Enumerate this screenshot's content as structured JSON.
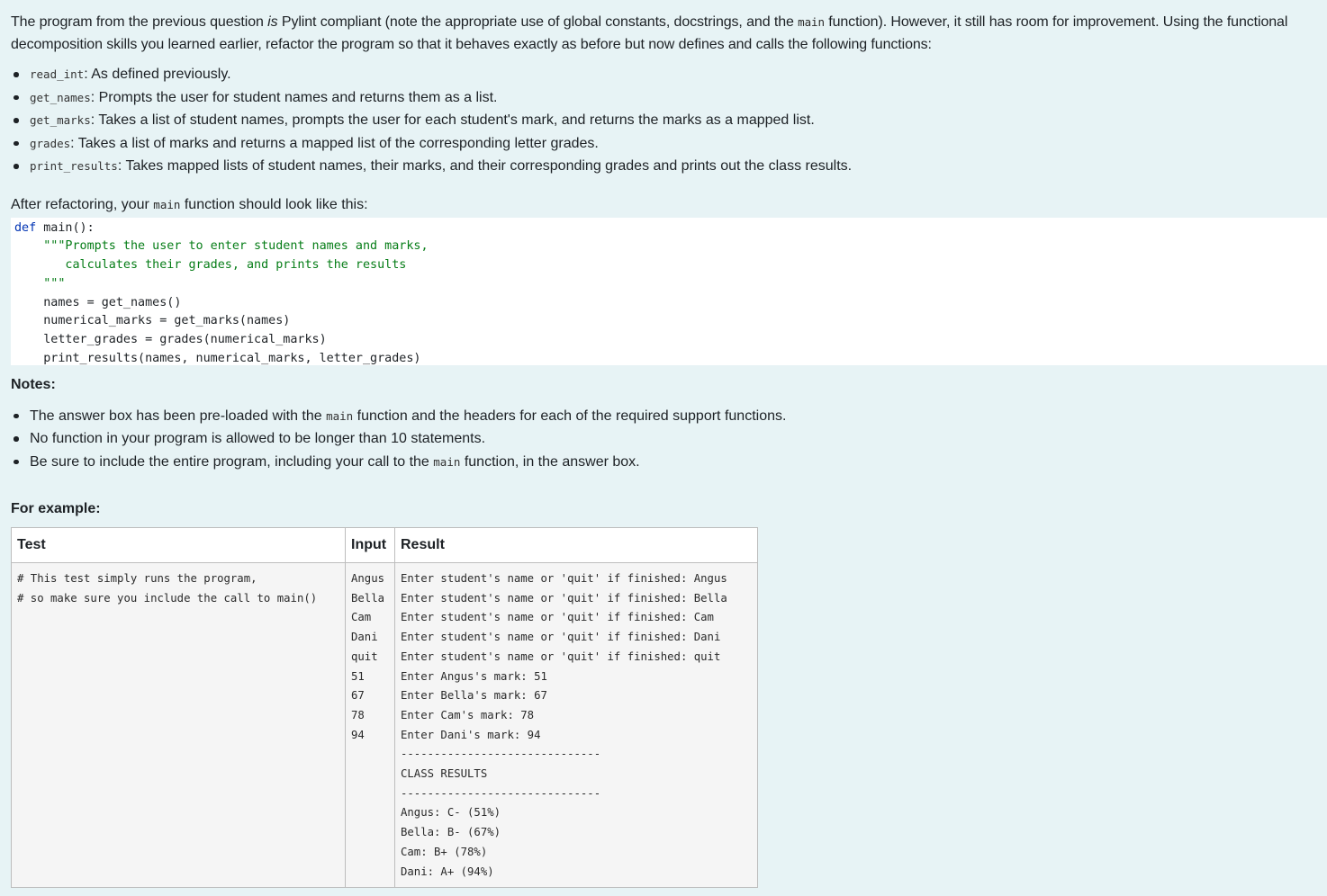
{
  "intro": {
    "p1": "The program from the previous question",
    "is": "is",
    "p2": "Pylint compliant (note the appropriate use of global constants, docstrings, and the",
    "main": "main",
    "p3": "function). However, it still has room for improvement. Using the",
    "p4": "functional decomposition skills you learned earlier, refactor the program so that it behaves exactly as before but now defines and calls the following functions:"
  },
  "functions": [
    {
      "name": "read_int",
      "desc": ": As defined previously."
    },
    {
      "name": "get_names",
      "desc": ": Prompts the user for student names and returns them as a list."
    },
    {
      "name": "get_marks",
      "desc": ": Takes a list of student names, prompts the user for each student's mark, and returns the marks as a mapped list."
    },
    {
      "name": "grades",
      "desc": ": Takes a list of marks and returns a mapped list of the corresponding letter grades."
    },
    {
      "name": "print_results",
      "desc": ": Takes mapped lists of student names, their marks, and their corresponding grades and prints out the class results."
    }
  ],
  "after": {
    "pre": "After refactoring, your",
    "code": "main",
    "post": "function should look like this:"
  },
  "code_block": {
    "kw_def": "def",
    "sig": " main():",
    "doc1": "    \"\"\"Prompts the user to enter student names and marks,",
    "doc2": "       calculates their grades, and prints the results",
    "doc3": "    \"\"\"",
    "l1": "    names = get_names()",
    "l2": "    numerical_marks = get_marks(names)",
    "l3": "    letter_grades = grades(numerical_marks)",
    "l4": "    print_results(names, numerical_marks, letter_grades)"
  },
  "notes": {
    "heading": "Notes:",
    "n1_pre": "The answer box has been pre-loaded with the",
    "n1_code": "main",
    "n1_post": "function and the headers for each of the required support functions.",
    "n2": "No function in your program is allowed to be longer than 10 statements.",
    "n3_pre": "Be sure to include the entire program, including your call to the",
    "n3_code": "main",
    "n3_post": "function, in the answer box."
  },
  "example": {
    "heading": "For example:",
    "headers": {
      "test": "Test",
      "input": "Input",
      "result": "Result"
    },
    "test": "# This test simply runs the program,\n# so make sure you include the call to main()",
    "input": "Angus\nBella\nCam\nDani\nquit\n51\n67\n78\n94",
    "result": "Enter student's name or 'quit' if finished: Angus\nEnter student's name or 'quit' if finished: Bella\nEnter student's name or 'quit' if finished: Cam\nEnter student's name or 'quit' if finished: Dani\nEnter student's name or 'quit' if finished: quit\nEnter Angus's mark: 51\nEnter Bella's mark: 67\nEnter Cam's mark: 78\nEnter Dani's mark: 94\n------------------------------\nCLASS RESULTS\n------------------------------\nAngus: C- (51%)\nBella: B- (67%)\nCam: B+ (78%)\nDani: A+ (94%)"
  }
}
